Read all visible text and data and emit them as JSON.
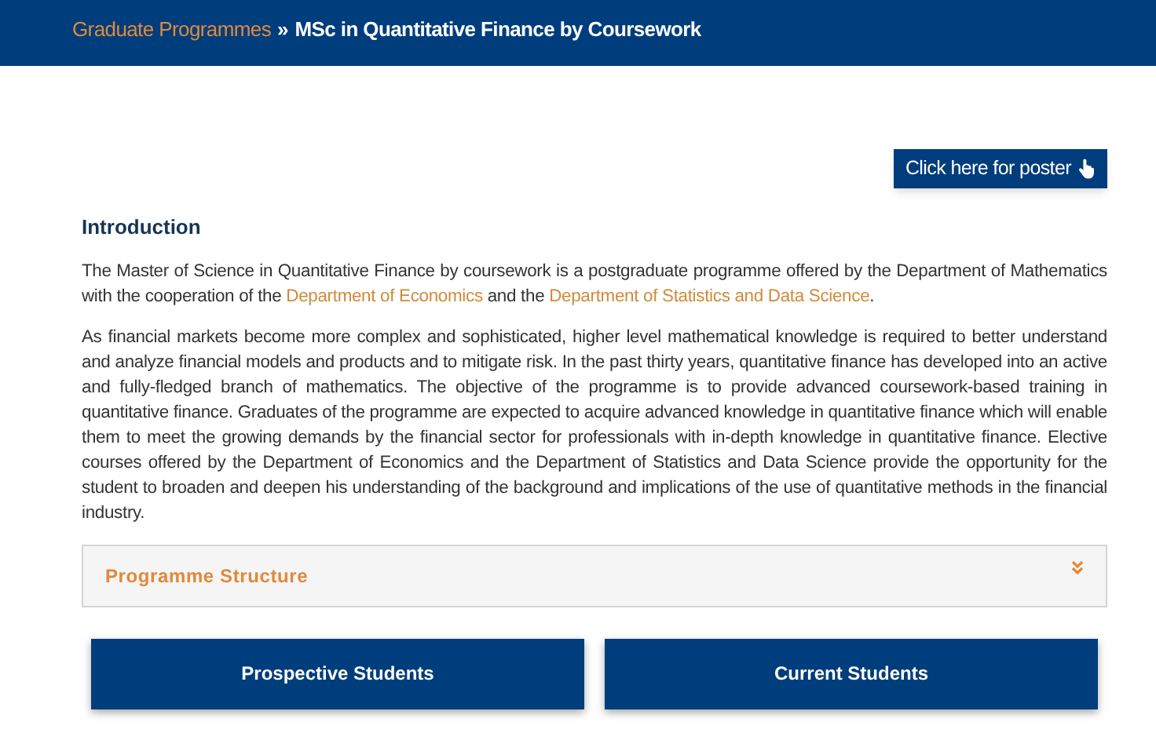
{
  "breadcrumb": {
    "parent": "Graduate Programmes",
    "separator": "»",
    "current": "MSc in Quantitative Finance by Coursework"
  },
  "poster_button": {
    "label": "Click here for poster"
  },
  "introduction": {
    "heading": "Introduction",
    "paragraphs": [
      [
        {
          "kind": "text",
          "text": "The Master of Science in Quantitative Finance by coursework is a postgraduate programme offered by the Department of Mathematics with the cooperation of the "
        },
        {
          "kind": "link",
          "text": "Department of Economics"
        },
        {
          "kind": "text",
          "text": " and the "
        },
        {
          "kind": "link",
          "text": "Department of Statistics and Data Science"
        },
        {
          "kind": "text",
          "text": "."
        }
      ],
      [
        {
          "kind": "text",
          "text": "As financial markets become more complex and sophisticated, higher level mathematical knowledge is required to better understand and analyze financial models and products and to mitigate risk. In the past thirty years, quantitative finance has developed into an active and fully-fledged branch of mathematics. The objective of the programme is to provide advanced coursework-based training in quantitative finance. Graduates of the programme are expected to acquire advanced knowledge in quantitative finance which will enable them to meet the growing demands by the financial sector for professionals with in-depth knowledge in quantitative finance. Elective courses offered by the Department of Economics and the Department of Statistics and Data Science provide the opportunity for the student to broaden and deepen his understanding of the background and implications of the use of quantitative methods in the financial industry."
        }
      ]
    ]
  },
  "accordion": {
    "title": "Programme Structure",
    "expanded": false
  },
  "buttons": [
    "Prospective Students",
    "Current Students"
  ]
}
